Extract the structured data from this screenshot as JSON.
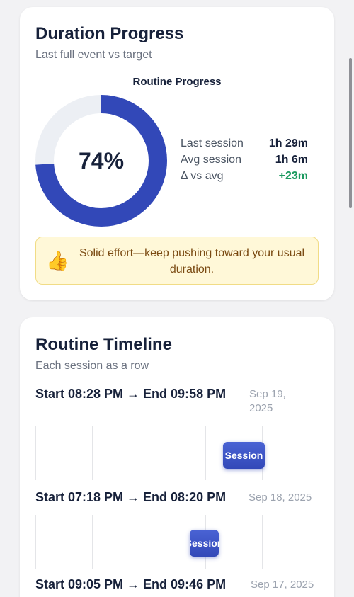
{
  "progress_card": {
    "title": "Duration Progress",
    "subtitle": "Last full event vs target",
    "ring_title": "Routine Progress",
    "percent_label": "74%",
    "percent_value": 74,
    "ring_color": "#3248b8",
    "ring_track_color": "#eceff4",
    "stats": [
      {
        "label": "Last session",
        "value": "1h 29m"
      },
      {
        "label": "Avg session",
        "value": "1h 6m"
      },
      {
        "label": "Δ vs avg",
        "value": "+23m"
      }
    ],
    "advice": {
      "icon": "thumbs-up-icon",
      "emoji": "👍",
      "text": "Solid effort—keep pushing toward your usual duration."
    }
  },
  "timeline_card": {
    "title": "Routine Timeline",
    "subtitle": "Each session as a row",
    "bar_label": "Session",
    "sessions": [
      {
        "range": "Start 08:28 PM → End 09:58 PM",
        "date": "Sep 19, 2025"
      },
      {
        "range": "Start 07:18 PM → End 08:20 PM",
        "date": "Sep 18, 2025"
      },
      {
        "range": "Start 09:05 PM → End 09:46 PM",
        "date": "Sep 17, 2025"
      }
    ]
  }
}
